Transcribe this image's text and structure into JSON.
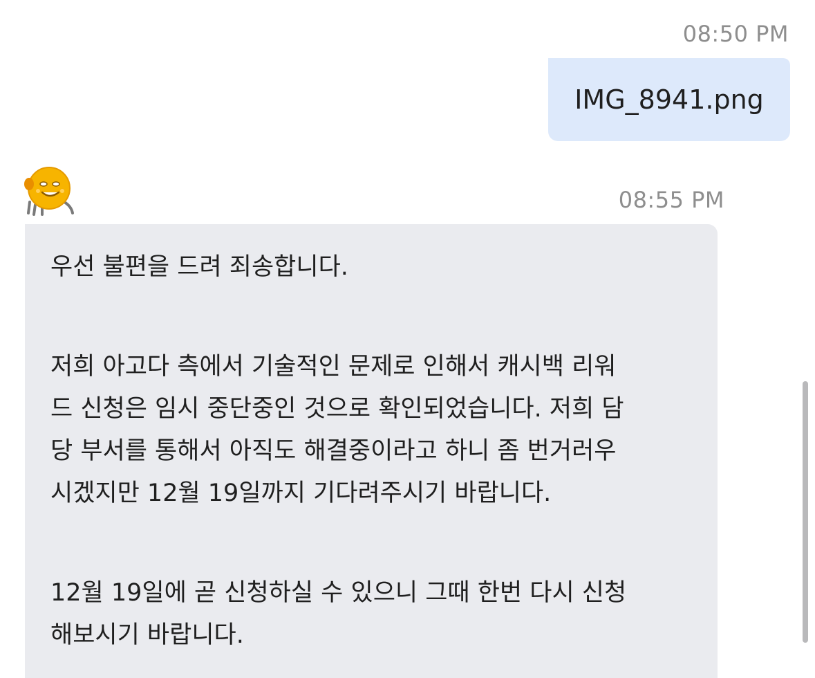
{
  "outgoing": {
    "time": "08:50 PM",
    "attachment_name": "IMG_8941.png"
  },
  "incoming": {
    "avatar_icon": "smiling-bot-mascot-icon",
    "time": "08:55 PM",
    "paragraphs": [
      "우선 불편을 드려 죄송합니다.",
      "저희 아고다 측에서 기술적인 문제로 인해서 캐시백 리워\n드 신청은 임시 중단중인 것으로 확인되었습니다. 저희 담\n당 부서를 통해서 아직도 해결중이라고 하니 좀 번거러우\n시겠지만 12월 19일까지 기다려주시기 바랍니다.",
      "12월 19일에 곧 신청하실 수 있으니 그때 한번 다시 신청\n해보시기 바랍니다."
    ]
  },
  "colors": {
    "outgoing_bubble": "#dde9fb",
    "incoming_bubble": "#eaebef",
    "timestamp": "#8e8e8e",
    "avatar": "#f7b400"
  }
}
